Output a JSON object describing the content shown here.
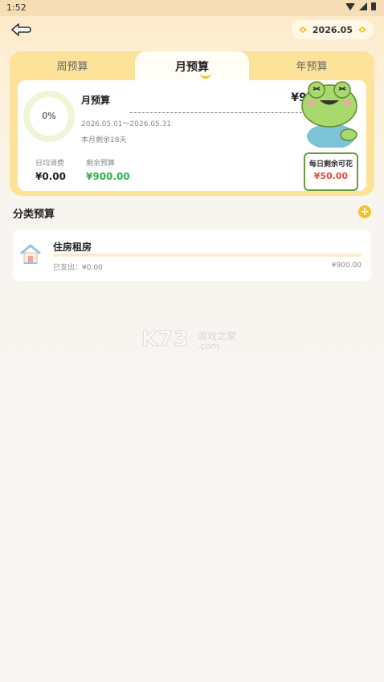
{
  "status": {
    "time": "1:52"
  },
  "header": {
    "date_label": "2026.05"
  },
  "tabs": [
    {
      "label": "周预算",
      "active": false
    },
    {
      "label": "月预算",
      "active": true
    },
    {
      "label": "年预算",
      "active": false
    }
  ],
  "budget": {
    "progress_label": "0%",
    "progress": 0,
    "title": "月预算",
    "amount": "¥900.00",
    "range": "2026.05.01～2026.05.31",
    "remaining_days": "本月剩余18天",
    "daily_label": "日均消费",
    "daily_value": "¥0.00",
    "left_label": "剩余预算",
    "left_value": "¥900.00"
  },
  "mascot": {
    "sign_title": "每日剩余可花",
    "sign_value": "¥50.00"
  },
  "categories_section": {
    "title": "分类预算"
  },
  "categories": [
    {
      "name": "住房租房",
      "spent": "已支出：¥0.00",
      "budget": "¥900.00",
      "progress": 0
    }
  ],
  "watermark": {
    "big": "K73",
    "cn": "游戏之家",
    "com": ".com"
  },
  "colors": {
    "accent": "#f4c12a",
    "card": "#fde39a",
    "green": "#2db34a"
  }
}
